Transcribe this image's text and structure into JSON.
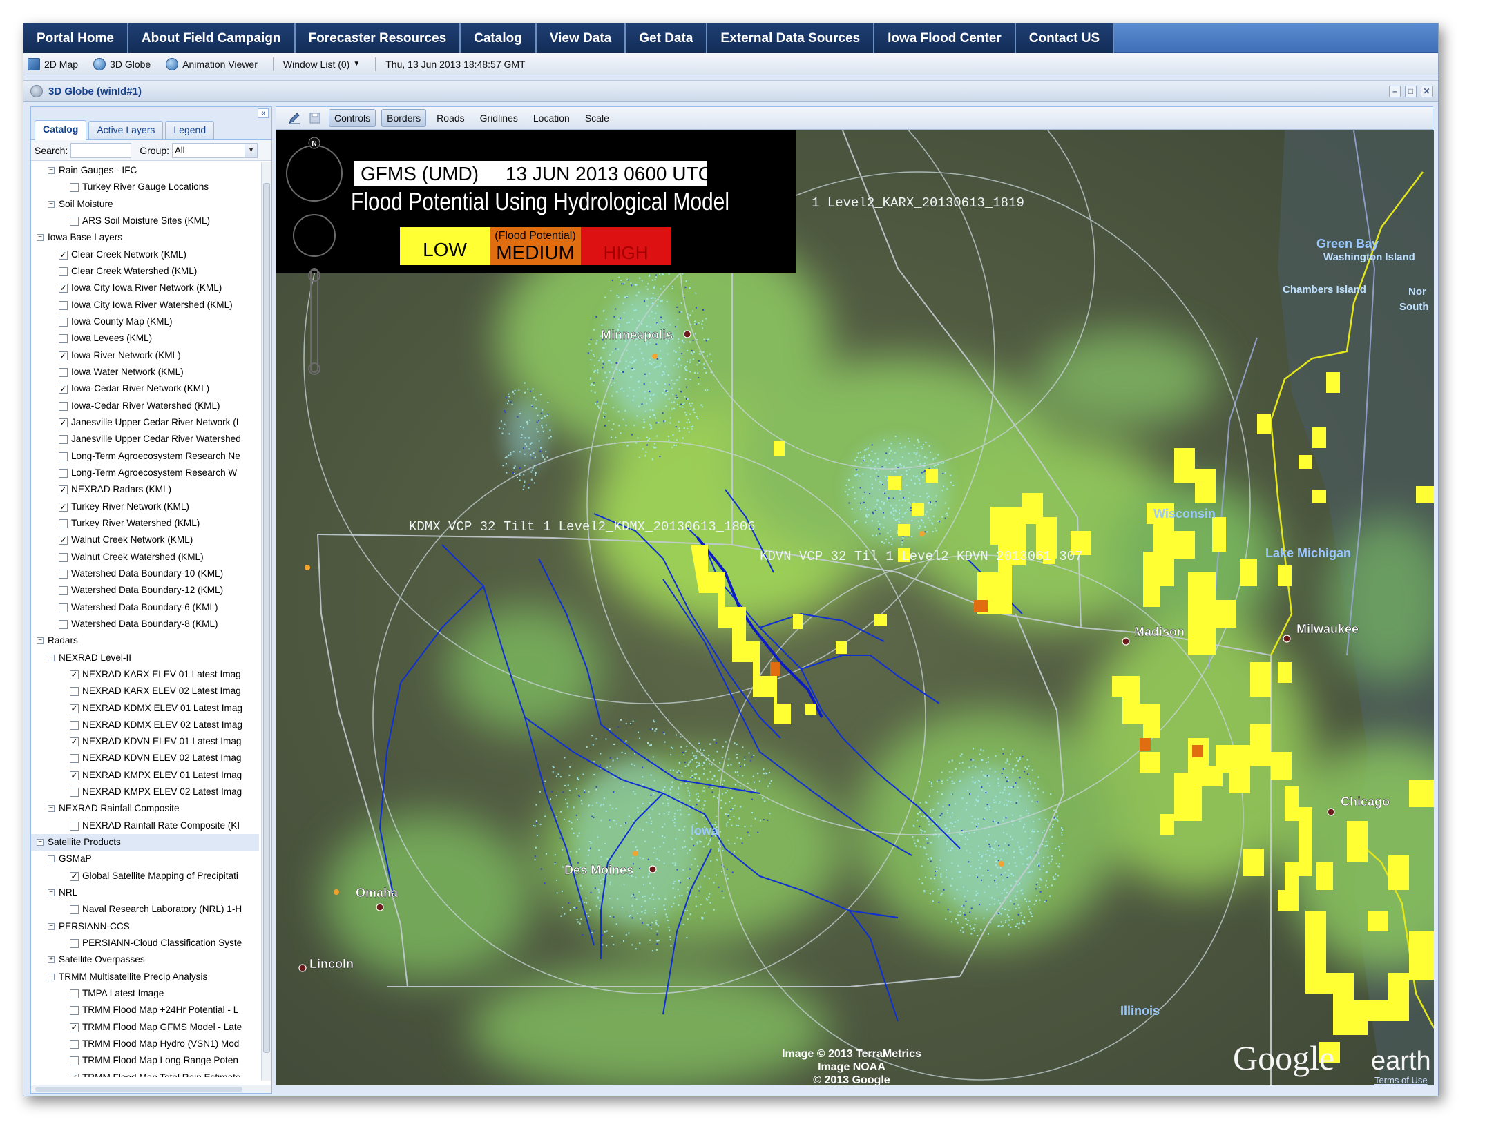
{
  "nav": [
    "Portal Home",
    "About Field Campaign",
    "Forecaster Resources",
    "Catalog",
    "View Data",
    "Get Data",
    "External Data Sources",
    "Iowa Flood Center",
    "Contact US"
  ],
  "toolbar": {
    "map2d": "2D Map",
    "globe3d": "3D Globe",
    "anim": "Animation Viewer",
    "windows": "Window List (0)",
    "datetime": "Thu, 13 Jun 2013 18:48:57 GMT"
  },
  "window": {
    "title": "3D Globe (winId#1)"
  },
  "left": {
    "tabs": [
      "Catalog",
      "Active Layers",
      "Legend"
    ],
    "search_label": "Search:",
    "search_value": "",
    "group_label": "Group:",
    "group_value": "All"
  },
  "tree": [
    {
      "d": 1,
      "t": "m",
      "l": "Rain Gauges - IFC"
    },
    {
      "d": 3,
      "t": "c",
      "c": 0,
      "l": "Turkey River Gauge Locations"
    },
    {
      "d": 1,
      "t": "m",
      "l": "Soil Moisture"
    },
    {
      "d": 3,
      "t": "c",
      "c": 0,
      "l": "ARS Soil Moisture Sites (KML)"
    },
    {
      "d": 0,
      "t": "m",
      "l": "Iowa Base Layers"
    },
    {
      "d": 2,
      "t": "c",
      "c": 1,
      "l": "Clear Creek Network (KML)"
    },
    {
      "d": 2,
      "t": "c",
      "c": 0,
      "l": "Clear Creek Watershed (KML)"
    },
    {
      "d": 2,
      "t": "c",
      "c": 1,
      "l": "Iowa City Iowa River Network (KML)"
    },
    {
      "d": 2,
      "t": "c",
      "c": 0,
      "l": "Iowa City Iowa River Watershed (KML)"
    },
    {
      "d": 2,
      "t": "c",
      "c": 0,
      "l": "Iowa County Map (KML)"
    },
    {
      "d": 2,
      "t": "c",
      "c": 0,
      "l": "Iowa Levees (KML)"
    },
    {
      "d": 2,
      "t": "c",
      "c": 1,
      "l": "Iowa River Network (KML)"
    },
    {
      "d": 2,
      "t": "c",
      "c": 0,
      "l": "Iowa Water Network (KML)"
    },
    {
      "d": 2,
      "t": "c",
      "c": 1,
      "l": "Iowa-Cedar River Network (KML)"
    },
    {
      "d": 2,
      "t": "c",
      "c": 0,
      "l": "Iowa-Cedar River Watershed (KML)"
    },
    {
      "d": 2,
      "t": "c",
      "c": 1,
      "l": "Janesville Upper Cedar River Network (I"
    },
    {
      "d": 2,
      "t": "c",
      "c": 0,
      "l": "Janesville Upper Cedar River Watershed"
    },
    {
      "d": 2,
      "t": "c",
      "c": 0,
      "l": "Long-Term Agroecosystem Research Ne"
    },
    {
      "d": 2,
      "t": "c",
      "c": 0,
      "l": "Long-Term Agroecosystem Research W"
    },
    {
      "d": 2,
      "t": "c",
      "c": 1,
      "l": "NEXRAD Radars (KML)"
    },
    {
      "d": 2,
      "t": "c",
      "c": 1,
      "l": "Turkey River Network (KML)"
    },
    {
      "d": 2,
      "t": "c",
      "c": 0,
      "l": "Turkey River Watershed (KML)"
    },
    {
      "d": 2,
      "t": "c",
      "c": 1,
      "l": "Walnut Creek Network (KML)"
    },
    {
      "d": 2,
      "t": "c",
      "c": 0,
      "l": "Walnut Creek Watershed (KML)"
    },
    {
      "d": 2,
      "t": "c",
      "c": 0,
      "l": "Watershed Data Boundary-10 (KML)"
    },
    {
      "d": 2,
      "t": "c",
      "c": 0,
      "l": "Watershed Data Boundary-12 (KML)"
    },
    {
      "d": 2,
      "t": "c",
      "c": 0,
      "l": "Watershed Data Boundary-6 (KML)"
    },
    {
      "d": 2,
      "t": "c",
      "c": 0,
      "l": "Watershed Data Boundary-8 (KML)"
    },
    {
      "d": 0,
      "t": "m",
      "l": "Radars"
    },
    {
      "d": 1,
      "t": "m",
      "l": "NEXRAD Level-II"
    },
    {
      "d": 3,
      "t": "c",
      "c": 1,
      "l": "NEXRAD KARX ELEV 01 Latest Imag"
    },
    {
      "d": 3,
      "t": "c",
      "c": 0,
      "l": "NEXRAD KARX ELEV 02 Latest Imag"
    },
    {
      "d": 3,
      "t": "c",
      "c": 1,
      "l": "NEXRAD KDMX ELEV 01 Latest Imag"
    },
    {
      "d": 3,
      "t": "c",
      "c": 0,
      "l": "NEXRAD KDMX ELEV 02 Latest Imag"
    },
    {
      "d": 3,
      "t": "c",
      "c": 1,
      "l": "NEXRAD KDVN ELEV 01 Latest Imag"
    },
    {
      "d": 3,
      "t": "c",
      "c": 0,
      "l": "NEXRAD KDVN ELEV 02 Latest Imag"
    },
    {
      "d": 3,
      "t": "c",
      "c": 1,
      "l": "NEXRAD KMPX ELEV 01 Latest Imag"
    },
    {
      "d": 3,
      "t": "c",
      "c": 0,
      "l": "NEXRAD KMPX ELEV 02 Latest Imag"
    },
    {
      "d": 1,
      "t": "m",
      "l": "NEXRAD Rainfall Composite"
    },
    {
      "d": 3,
      "t": "c",
      "c": 0,
      "l": "NEXRAD Rainfall Rate Composite (KI"
    },
    {
      "d": 0,
      "t": "m",
      "l": "Satellite Products",
      "sel": 1
    },
    {
      "d": 1,
      "t": "m",
      "l": "GSMaP"
    },
    {
      "d": 3,
      "t": "c",
      "c": 1,
      "l": "Global Satellite Mapping of Precipitati"
    },
    {
      "d": 1,
      "t": "m",
      "l": "NRL"
    },
    {
      "d": 3,
      "t": "c",
      "c": 0,
      "l": "Naval Research Laboratory (NRL) 1-H"
    },
    {
      "d": 1,
      "t": "m",
      "l": "PERSIANN-CCS"
    },
    {
      "d": 3,
      "t": "c",
      "c": 0,
      "l": "PERSIANN-Cloud Classification Syste"
    },
    {
      "d": 1,
      "t": "p",
      "l": "Satellite Overpasses"
    },
    {
      "d": 1,
      "t": "m",
      "l": "TRMM Multisatellite Precip Analysis"
    },
    {
      "d": 3,
      "t": "c",
      "c": 0,
      "l": "TMPA Latest Image"
    },
    {
      "d": 3,
      "t": "c",
      "c": 0,
      "l": "TRMM Flood Map +24Hr Potential - L"
    },
    {
      "d": 3,
      "t": "c",
      "c": 1,
      "l": "TRMM Flood Map GFMS Model - Late"
    },
    {
      "d": 3,
      "t": "c",
      "c": 0,
      "l": "TRMM Flood Map Hydro (VSN1) Mod"
    },
    {
      "d": 3,
      "t": "c",
      "c": 0,
      "l": "TRMM Flood Map Long Range Poten"
    },
    {
      "d": 3,
      "t": "c",
      "c": 1,
      "l": "TRMM Flood Map Total Rain Estimate"
    }
  ],
  "maptoolbar": [
    "Controls",
    "Borders",
    "Roads",
    "Gridlines",
    "Location",
    "Scale"
  ],
  "overlay": {
    "header": "GFMS (UMD)     13 JUN 2013 0600 UTC",
    "subtitle": "Flood Potential Using Hydrological Model",
    "legend_caption": "(Flood Potential)",
    "low": "LOW",
    "medium": "MEDIUM",
    "high": "HIGH",
    "north": "N",
    "colors": {
      "low": "#ffff33",
      "medium": "#e06d10",
      "high": "#dd1111"
    }
  },
  "radar_labels": {
    "karx": "1 Level2_KARX_20130613_1819",
    "kdmx": "KDMX VCP 32 Tilt  1 Level2_KDMX_20130613_1806",
    "kdvn": "KDVN VCP 32 Til  1 Level2_KDVN_2013061  307"
  },
  "places": {
    "minneapolis": "Minneapolis",
    "green_bay": "Green Bay",
    "washington_island": "Washington Island",
    "chambers_island": "Chambers Island",
    "north": "Nor",
    "south": "South",
    "wisconsin": "Wisconsin",
    "lake_michigan": "Lake Michigan",
    "madison": "Madison",
    "milwaukee": "Milwaukee",
    "chicago": "Chicago",
    "iowa": "Iowa",
    "des_moines": "Des Moines",
    "omaha": "Omaha",
    "lincoln": "Lincoln",
    "illinois": "Illinois"
  },
  "attribution": {
    "line1": "Image © 2013 TerraMetrics",
    "line2": "Image NOAA",
    "line3": "© 2013 Google",
    "google": "Google",
    "earth": "earth",
    "terms": "Terms of Use"
  }
}
